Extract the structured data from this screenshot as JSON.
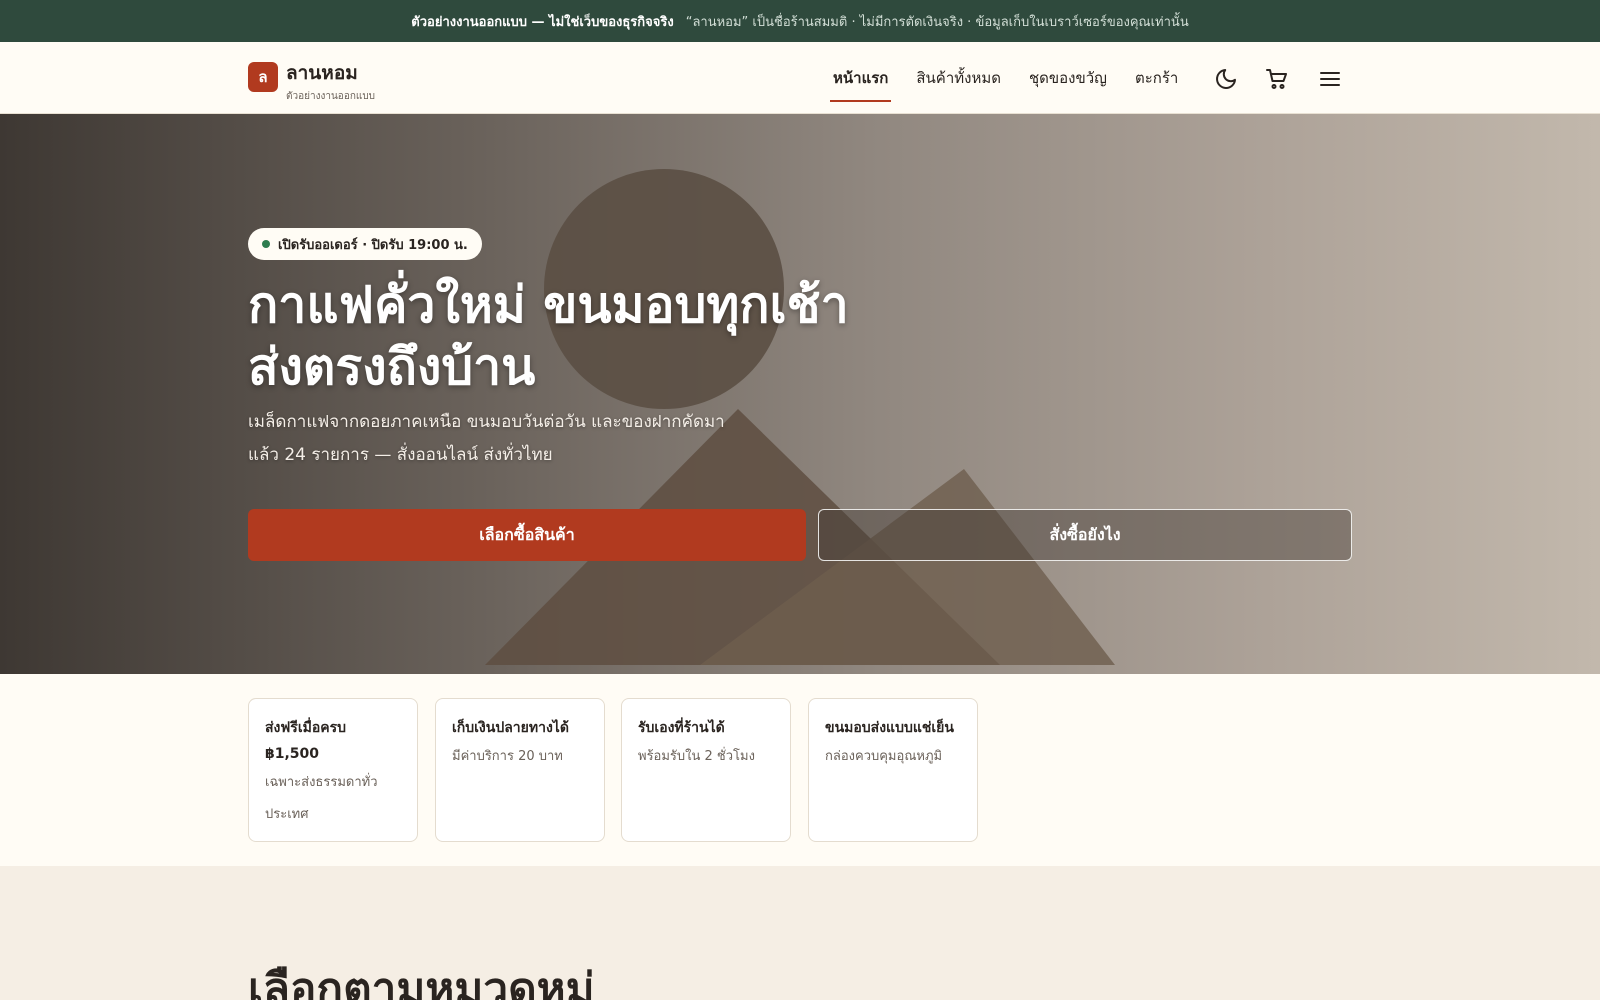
{
  "announcement": {
    "strong": "ตัวอย่างงานออกแบบ — ไม่ใช่เว็บของธุรกิจจริง",
    "note": "“ลานหอม” เป็นชื่อร้านสมมติ · ไม่มีการตัดเงินจริง · ข้อมูลเก็บในเบราว์เซอร์ของคุณเท่านั้น"
  },
  "brand": {
    "mark": "ล",
    "name": "ลานหอม",
    "tagline": "ตัวอย่างงานออกแบบ",
    "accent": "#b13a1f",
    "dark_green": "#2f4a3d"
  },
  "nav": {
    "items": [
      {
        "label": "หน้าแรก",
        "active": true
      },
      {
        "label": "สินค้าทั้งหมด",
        "active": false
      },
      {
        "label": "ชุดของขวัญ",
        "active": false
      },
      {
        "label": "ตะกร้า",
        "active": false
      }
    ],
    "icons": [
      "moon-icon",
      "cart-icon",
      "menu-icon"
    ]
  },
  "hero": {
    "badge": "เปิดรับออเดอร์ · ปิดรับ 19:00 น.",
    "title_line1": "กาแฟคั่วใหม่ ขนมอบทุกเช้า",
    "title_line2": "ส่งตรงถึงบ้าน",
    "subtitle_line1": "เมล็ดกาแฟจากดอยภาคเหนือ ขนมอบวันต่อวัน และของฝากคัดมา",
    "subtitle_line2": "แล้ว 24 รายการ — สั่งออนไลน์ ส่งทั่วไทย",
    "primary_cta": "เลือกซื้อสินค้า",
    "secondary_cta": "สั่งซื้อยังไง"
  },
  "features": [
    {
      "title_line1": "ส่งฟรีเมื่อครบ",
      "title_line2": "฿1,500",
      "desc_line1": "เฉพาะส่งธรรมดาทั่ว",
      "desc_line2": "ประเทศ"
    },
    {
      "title_line1": "เก็บเงินปลายทางได้",
      "desc_line1": "มีค่าบริการ 20 บาท"
    },
    {
      "title_line1": "รับเองที่ร้านได้",
      "desc_line1": "พร้อมรับใน 2 ชั่วโมง"
    },
    {
      "title_line1": "ขนมอบส่งแบบแช่เย็น",
      "desc_line1": "กล่องควบคุมอุณหภูมิ"
    }
  ],
  "categories_section": {
    "title": "เลือกตามหมวดหมู่"
  }
}
